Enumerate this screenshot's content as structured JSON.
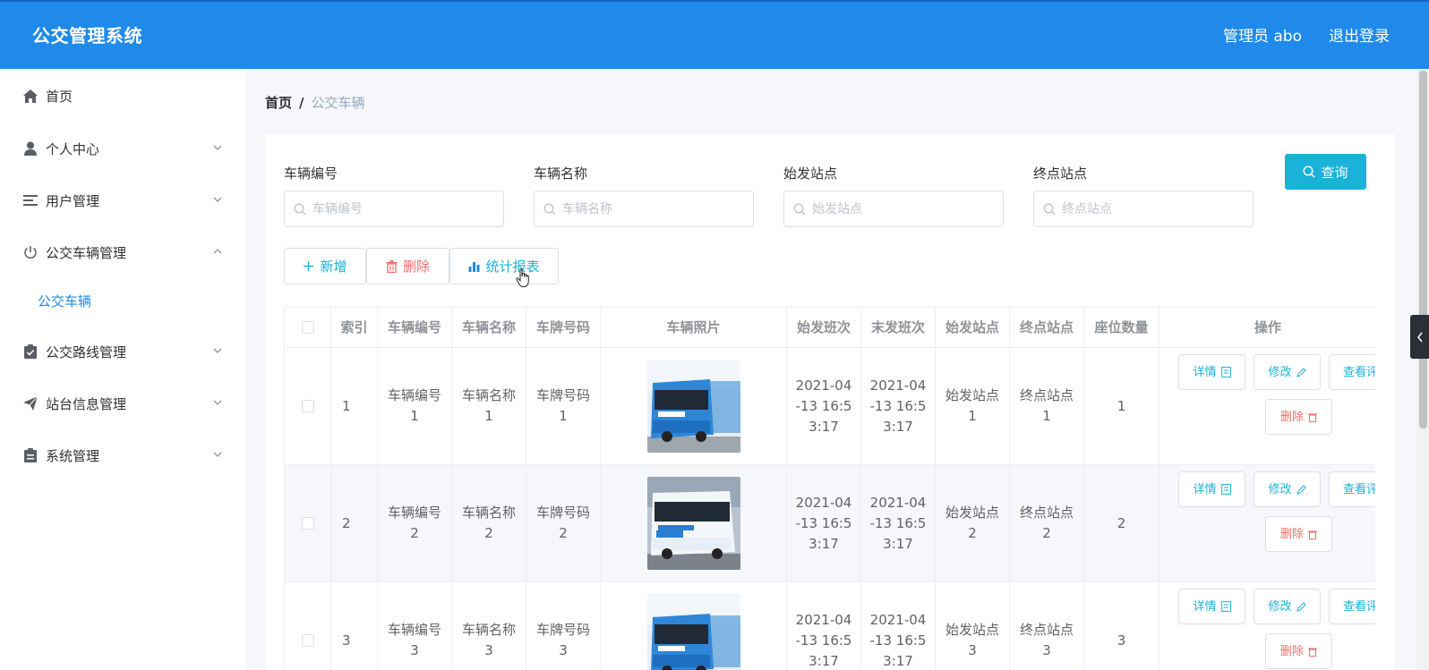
{
  "header": {
    "brand": "公交管理系统",
    "user": "管理员 abo",
    "logout": "退出登录"
  },
  "sidebar": {
    "items": [
      {
        "label": "首页",
        "icon": "home-icon"
      },
      {
        "label": "个人中心",
        "icon": "user-icon"
      },
      {
        "label": "用户管理",
        "icon": "list-icon"
      },
      {
        "label": "公交车辆管理",
        "icon": "power-icon"
      },
      {
        "label": "公交路线管理",
        "icon": "clipboard-check-icon"
      },
      {
        "label": "站台信息管理",
        "icon": "send-icon"
      },
      {
        "label": "系统管理",
        "icon": "clipboard-icon"
      }
    ],
    "active_sub": "公交车辆"
  },
  "breadcrumb": {
    "home": "首页",
    "separator": "/",
    "current": "公交车辆"
  },
  "search": {
    "fields": [
      {
        "label": "车辆编号",
        "placeholder": "车辆编号"
      },
      {
        "label": "车辆名称",
        "placeholder": "车辆名称"
      },
      {
        "label": "始发站点",
        "placeholder": "始发站点"
      },
      {
        "label": "终点站点",
        "placeholder": "终点站点"
      }
    ],
    "query_button": "查询"
  },
  "toolbar": {
    "add": "新增",
    "delete": "删除",
    "report": "统计报表"
  },
  "table": {
    "headers": [
      "索引",
      "车辆编号",
      "车辆名称",
      "车牌号码",
      "车辆照片",
      "始发班次",
      "末发班次",
      "始发站点",
      "终点站点",
      "座位数量",
      "操作"
    ],
    "rows": [
      {
        "index": "1",
        "code": "车辆编号1",
        "name": "车辆名称1",
        "plate": "车牌号码1",
        "first": "2021-04-13 16:53:17",
        "last": "2021-04-13 16:53:17",
        "start": "始发站点1",
        "end": "终点站点1",
        "seats": "1"
      },
      {
        "index": "2",
        "code": "车辆编号2",
        "name": "车辆名称2",
        "plate": "车牌号码2",
        "first": "2021-04-13 16:53:17",
        "last": "2021-04-13 16:53:17",
        "start": "始发站点2",
        "end": "终点站点2",
        "seats": "2"
      },
      {
        "index": "3",
        "code": "车辆编号3",
        "name": "车辆名称3",
        "plate": "车牌号码3",
        "first": "2021-04-13 16:53:17",
        "last": "2021-04-13 16:53:17",
        "start": "始发站点3",
        "end": "终点站点3",
        "seats": "3"
      }
    ],
    "actions": {
      "detail": "详情",
      "edit": "修改",
      "view": "查看评",
      "delete": "删除"
    }
  },
  "colors": {
    "header": "#1f8ae9",
    "accent": "#1ab2d8",
    "danger": "#f56c6c",
    "active_menu": "#1f8ae9"
  }
}
